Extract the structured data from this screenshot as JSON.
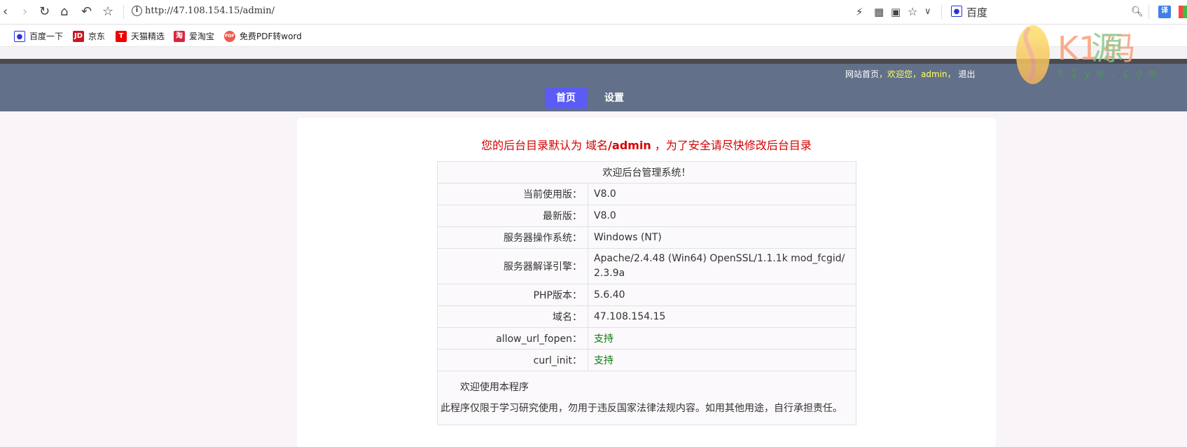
{
  "browser": {
    "url": "http://47.108.154.15/admin/",
    "search_engine": "百度",
    "icons": [
      "back-icon",
      "forward-icon",
      "reload-icon",
      "home-icon",
      "undo-icon",
      "star-icon",
      "info-icon",
      "lightning-icon",
      "qr-icon",
      "translate-icon",
      "star-icon",
      "chevron-down-icon",
      "baidu-icon",
      "search-icon",
      "translate-ext-icon",
      "apps-icon"
    ],
    "translate_ext_label": "译",
    "bookmarks": [
      {
        "label": "百度一下",
        "icon": "baidu-icon"
      },
      {
        "label": "京东",
        "icon": "JD"
      },
      {
        "label": "天猫精选",
        "icon": "T"
      },
      {
        "label": "爱淘宝",
        "icon": "淘"
      },
      {
        "label": "免费PDF转word",
        "icon": "PDF"
      }
    ]
  },
  "watermark": {
    "text": "K1源码",
    "sub": "k1ym.com"
  },
  "header": {
    "links": {
      "home": "网站首页",
      "sep1": "，",
      "welcome": "欢迎您",
      "sep2": "，",
      "user": "admin",
      "sep3": "，",
      "logout": "退出"
    },
    "nav": [
      {
        "label": "首页",
        "active": true
      },
      {
        "label": "设置",
        "active": false
      }
    ],
    "accent": "#5b5cf5",
    "bg": "#637089"
  },
  "notice": {
    "prefix": "您的后台目录默认为 域名",
    "path": "/admin",
    "suffix": " ，为了安全请尽快修改后台目录"
  },
  "table": {
    "title": "欢迎后台管理系统！",
    "rows": [
      {
        "label": "当前使用版：",
        "value": "V8.0"
      },
      {
        "label": "最新版：",
        "value": "V8.0"
      },
      {
        "label": "服务器操作系统：",
        "value": "Windows (NT)"
      },
      {
        "label": "服务器解译引擎：",
        "value": "Apache/2.4.48 (Win64) OpenSSL/1.1.1k mod_fcgid/2.3.9a"
      },
      {
        "label": "PHP版本：",
        "value": "5.6.40"
      },
      {
        "label": "域名：",
        "value": "47.108.154.15"
      },
      {
        "label": "allow_url_fopen：",
        "value": "支持"
      },
      {
        "label": "curl_init：",
        "value": "支持"
      }
    ],
    "footer_line1": "欢迎使用本程序",
    "footer_line2": "此程序仅限于学习研究使用，勿用于违反国家法律法规内容。如用其他用途，自行承担责任。"
  }
}
